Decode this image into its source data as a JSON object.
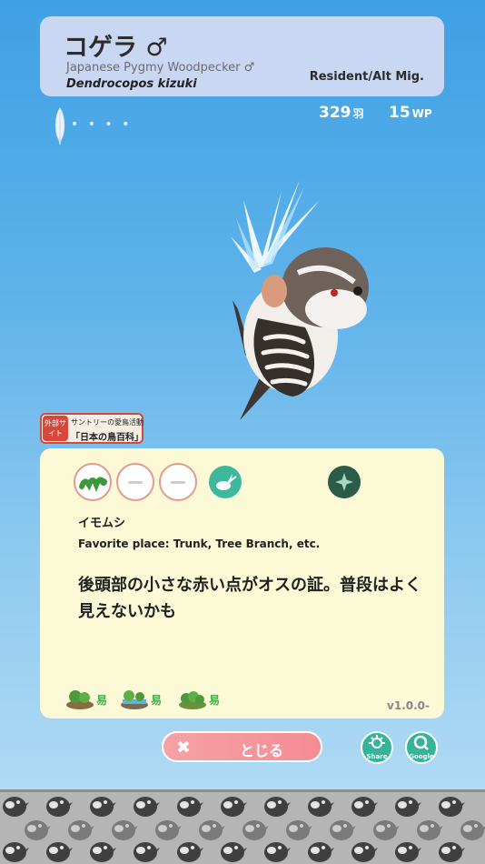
{
  "header": {
    "name": "コゲラ ♂",
    "english_name": "Japanese Pygmy Woodpecker ♂",
    "scientific_name": "Dendrocopos kizuki",
    "status": "Resident/Alt Mig."
  },
  "progress": {
    "dots": "• • • •"
  },
  "stats": {
    "count": "329",
    "count_unit": "羽",
    "wp": "15",
    "wp_unit": "WP"
  },
  "external_link": {
    "badge": "外部サイト",
    "line1": "サントリーの愛鳥活動",
    "line2": "「日本の鳥百科」"
  },
  "info": {
    "food_name": "イモムシ",
    "favorite_place": "Favorite place: Trunk, Tree Branch, etc.",
    "description": "後頭部の小さな赤い点がオスの証。普段はよく見えないかも",
    "habitats": [
      {
        "label": "易"
      },
      {
        "label": "易"
      },
      {
        "label": "易"
      }
    ],
    "version": "v1.0.0-"
  },
  "buttons": {
    "close": "とじる",
    "share": "Share",
    "google": "Google"
  },
  "colors": {
    "sky_top": "#3fa0e4",
    "card_header": "#c9d7f3",
    "card_info": "#fbf9d6",
    "close_button": "#f48c94",
    "accent_green": "#35b49a"
  },
  "icons": {
    "food_1": "caterpillar-icon",
    "behavior": "rabbit-icon",
    "special": "sparkle-icon",
    "share": "share-icon",
    "google": "search-icon"
  }
}
